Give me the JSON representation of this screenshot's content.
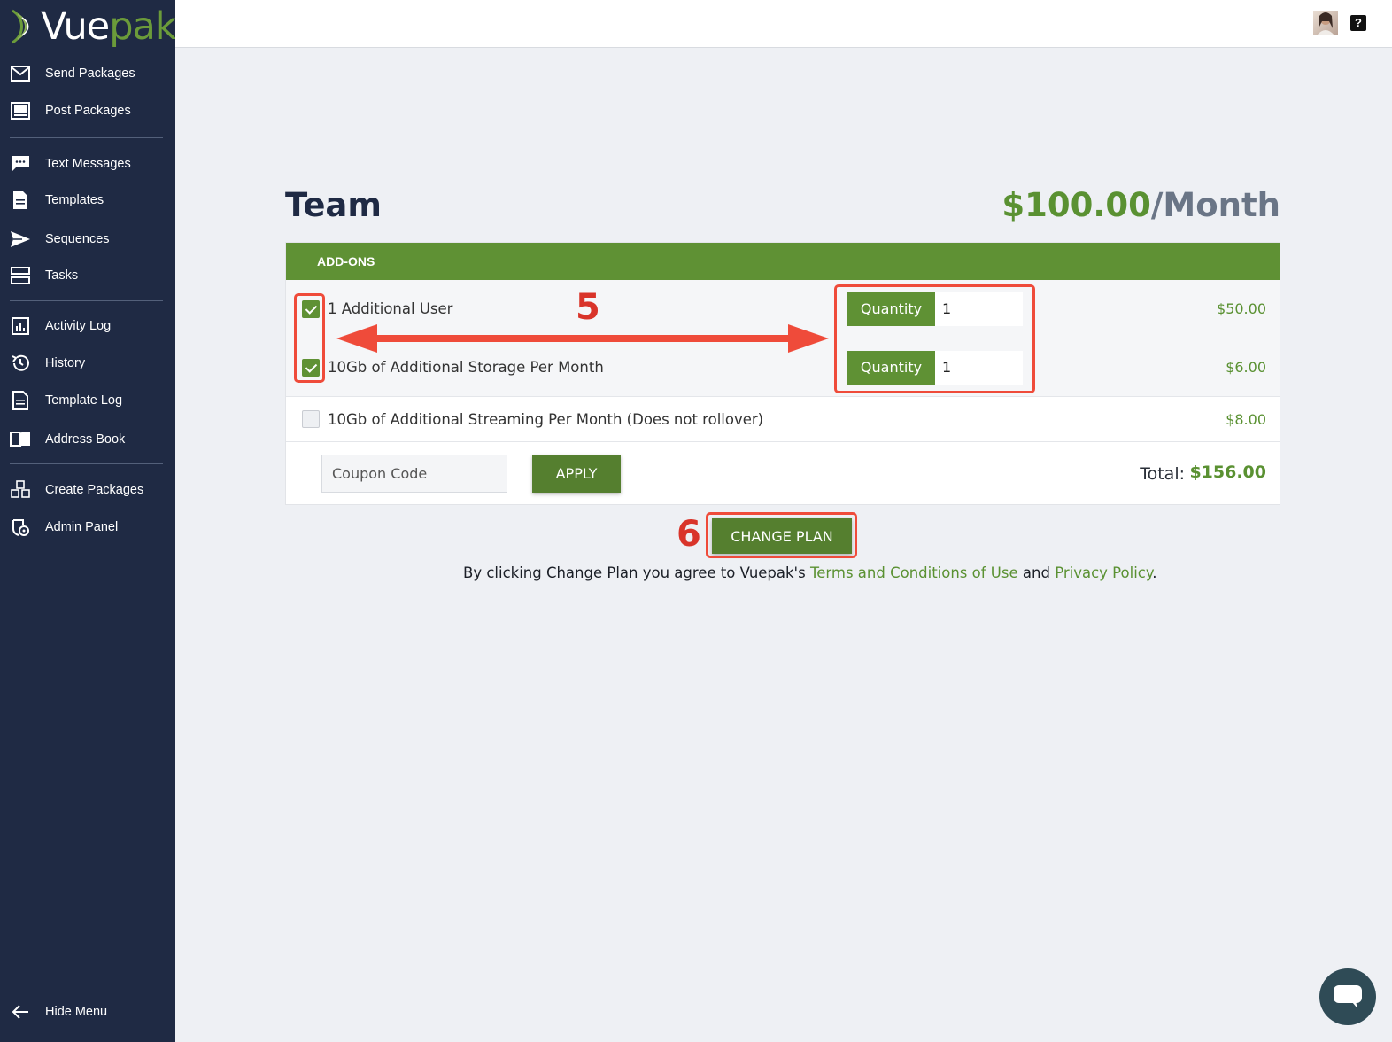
{
  "app": {
    "logo_part1": "Vue",
    "logo_part2": "pak"
  },
  "sidebar": {
    "items": [
      {
        "label": "Send Packages",
        "icon": "envelope-icon"
      },
      {
        "label": "Post Packages",
        "icon": "post-icon"
      },
      {
        "label": "Text Messages",
        "icon": "chat-bubble-icon"
      },
      {
        "label": "Templates",
        "icon": "document-icon"
      },
      {
        "label": "Sequences",
        "icon": "paper-plane-icon"
      },
      {
        "label": "Tasks",
        "icon": "tasks-icon"
      },
      {
        "label": "Activity Log",
        "icon": "bar-chart-icon"
      },
      {
        "label": "History",
        "icon": "history-icon"
      },
      {
        "label": "Template Log",
        "icon": "document-list-icon"
      },
      {
        "label": "Address Book",
        "icon": "book-icon"
      },
      {
        "label": "Create Packages",
        "icon": "cubes-icon"
      },
      {
        "label": "Admin Panel",
        "icon": "admin-icon"
      }
    ],
    "hide_menu": "Hide Menu"
  },
  "topbar": {
    "help_label": "?"
  },
  "plan": {
    "name": "Team",
    "price": "$100.00",
    "period": "/Month"
  },
  "addons": {
    "header": "ADD-ONS",
    "rows": [
      {
        "label": "1 Additional User",
        "checked": true,
        "quantity_label": "Quantity",
        "quantity": "1",
        "price": "$50.00"
      },
      {
        "label": "10Gb of Additional Storage Per Month",
        "checked": true,
        "quantity_label": "Quantity",
        "quantity": "1",
        "price": "$6.00"
      },
      {
        "label": "10Gb of Additional Streaming Per Month (Does not rollover)",
        "checked": false,
        "price": "$8.00"
      }
    ],
    "coupon_placeholder": "Coupon Code",
    "apply_label": "APPLY",
    "total_label": "Total:",
    "total_value": "$156.00"
  },
  "actions": {
    "change_plan": "CHANGE PLAN",
    "agree_prefix": "By clicking Change Plan you agree to Vuepak's ",
    "terms_link": "Terms and Conditions of Use",
    "agree_and": " and ",
    "privacy_link": "Privacy Policy",
    "agree_suffix": "."
  },
  "annotations": {
    "step5": "5",
    "step6": "6",
    "color": "#ef4b3a"
  },
  "colors": {
    "sidebar_bg": "#1f2a44",
    "accent_green": "#5f9134",
    "price_green": "#5a9132"
  }
}
